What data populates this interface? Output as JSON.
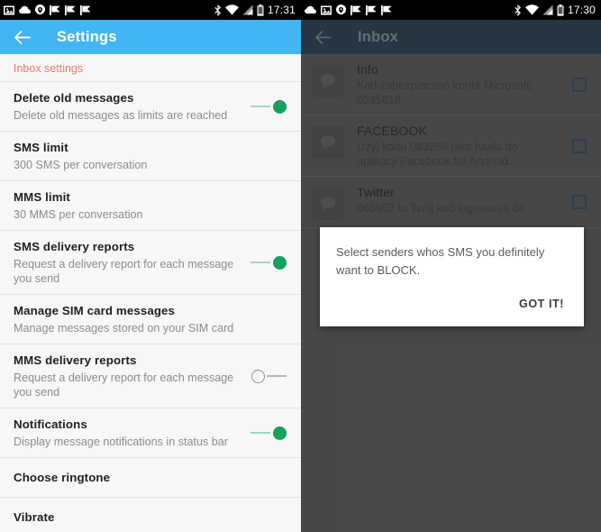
{
  "left": {
    "statusbar": {
      "time": "17:31",
      "left_icons": [
        "photo-icon",
        "cloud-icon",
        "location-icon",
        "flag-icon",
        "flag-icon",
        "flag-icon"
      ],
      "right_icons": [
        "bluetooth-icon",
        "wifi-icon",
        "cellular-signal-icon",
        "battery-icon"
      ]
    },
    "appbar": {
      "title": "Settings",
      "back_icon": "back-arrow-icon",
      "color": "#41b6f2"
    },
    "section_header": "Inbox settings",
    "section_header_color": "#e87b6e",
    "rows": [
      {
        "title": "Delete old messages",
        "subtitle": "Delete old messages as limits are reached",
        "toggle": "on"
      },
      {
        "title": "SMS limit",
        "subtitle": "300 SMS per conversation",
        "toggle": null
      },
      {
        "title": "MMS limit",
        "subtitle": "30 MMS per conversation",
        "toggle": null
      },
      {
        "title": "SMS delivery reports",
        "subtitle": "Request a delivery report for each message you send",
        "toggle": "on"
      },
      {
        "title": "Manage SIM card messages",
        "subtitle": "Manage messages stored on your SIM card",
        "toggle": null
      },
      {
        "title": "MMS delivery reports",
        "subtitle": "Request a delivery report for each message you send",
        "toggle": "off"
      },
      {
        "title": "Notifications",
        "subtitle": "Display message notifications in status bar",
        "toggle": "on"
      },
      {
        "title": "Choose ringtone",
        "subtitle": null,
        "toggle": null
      },
      {
        "title": "Vibrate",
        "subtitle": null,
        "toggle": null
      }
    ],
    "toggle_on_color": "#16a15c",
    "toggle_off_color": "#8f8f8f"
  },
  "right": {
    "statusbar": {
      "time": "17:30",
      "left_icons": [
        "cloud-icon",
        "photo-icon",
        "location-icon",
        "flag-icon",
        "flag-icon",
        "flag-icon"
      ],
      "right_icons": [
        "bluetooth-icon",
        "wifi-icon",
        "cellular-signal-icon",
        "battery-icon"
      ]
    },
    "appbar": {
      "title": "Inbox",
      "back_icon": "back-arrow-icon",
      "color": "#3c5063"
    },
    "messages": [
      {
        "sender": "Info",
        "text": "Kod zabezpieczeń konta Microsoft: 0245818",
        "checked": false
      },
      {
        "sender": "FACEBOOK",
        "text": "Użyj kodu 083250 jako hasła do aplikacji Facebook for Android.",
        "checked": false
      },
      {
        "sender": "Twitter",
        "text": "063952 to Twój kod logowania do",
        "checked": false
      }
    ],
    "dialog": {
      "message": "Select senders whos SMS you definitely want to BLOCK.",
      "button": "GOT IT!"
    }
  }
}
